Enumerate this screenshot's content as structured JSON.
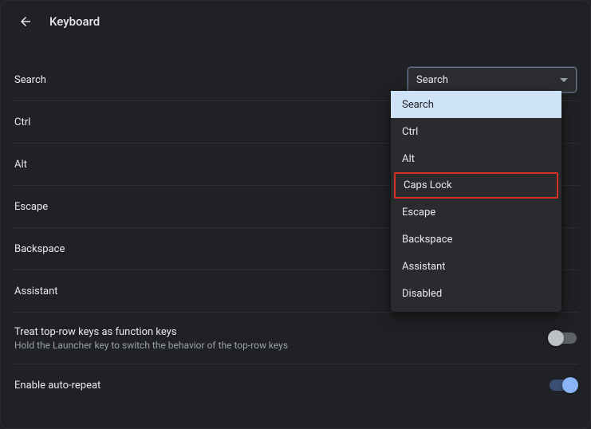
{
  "header": {
    "title": "Keyboard"
  },
  "rows": {
    "search": "Search",
    "ctrl": "Ctrl",
    "alt": "Alt",
    "escape": "Escape",
    "backspace": "Backspace",
    "assistant": "Assistant",
    "function_keys_title": "Treat top-row keys as function keys",
    "function_keys_sub": "Hold the Launcher key to switch the behavior of the top-row keys",
    "auto_repeat": "Enable auto-repeat"
  },
  "select": {
    "value": "Search"
  },
  "dropdown": {
    "items": [
      "Search",
      "Ctrl",
      "Alt",
      "Caps Lock",
      "Escape",
      "Backspace",
      "Assistant",
      "Disabled"
    ]
  },
  "toggles": {
    "function_keys": false,
    "auto_repeat": true
  }
}
